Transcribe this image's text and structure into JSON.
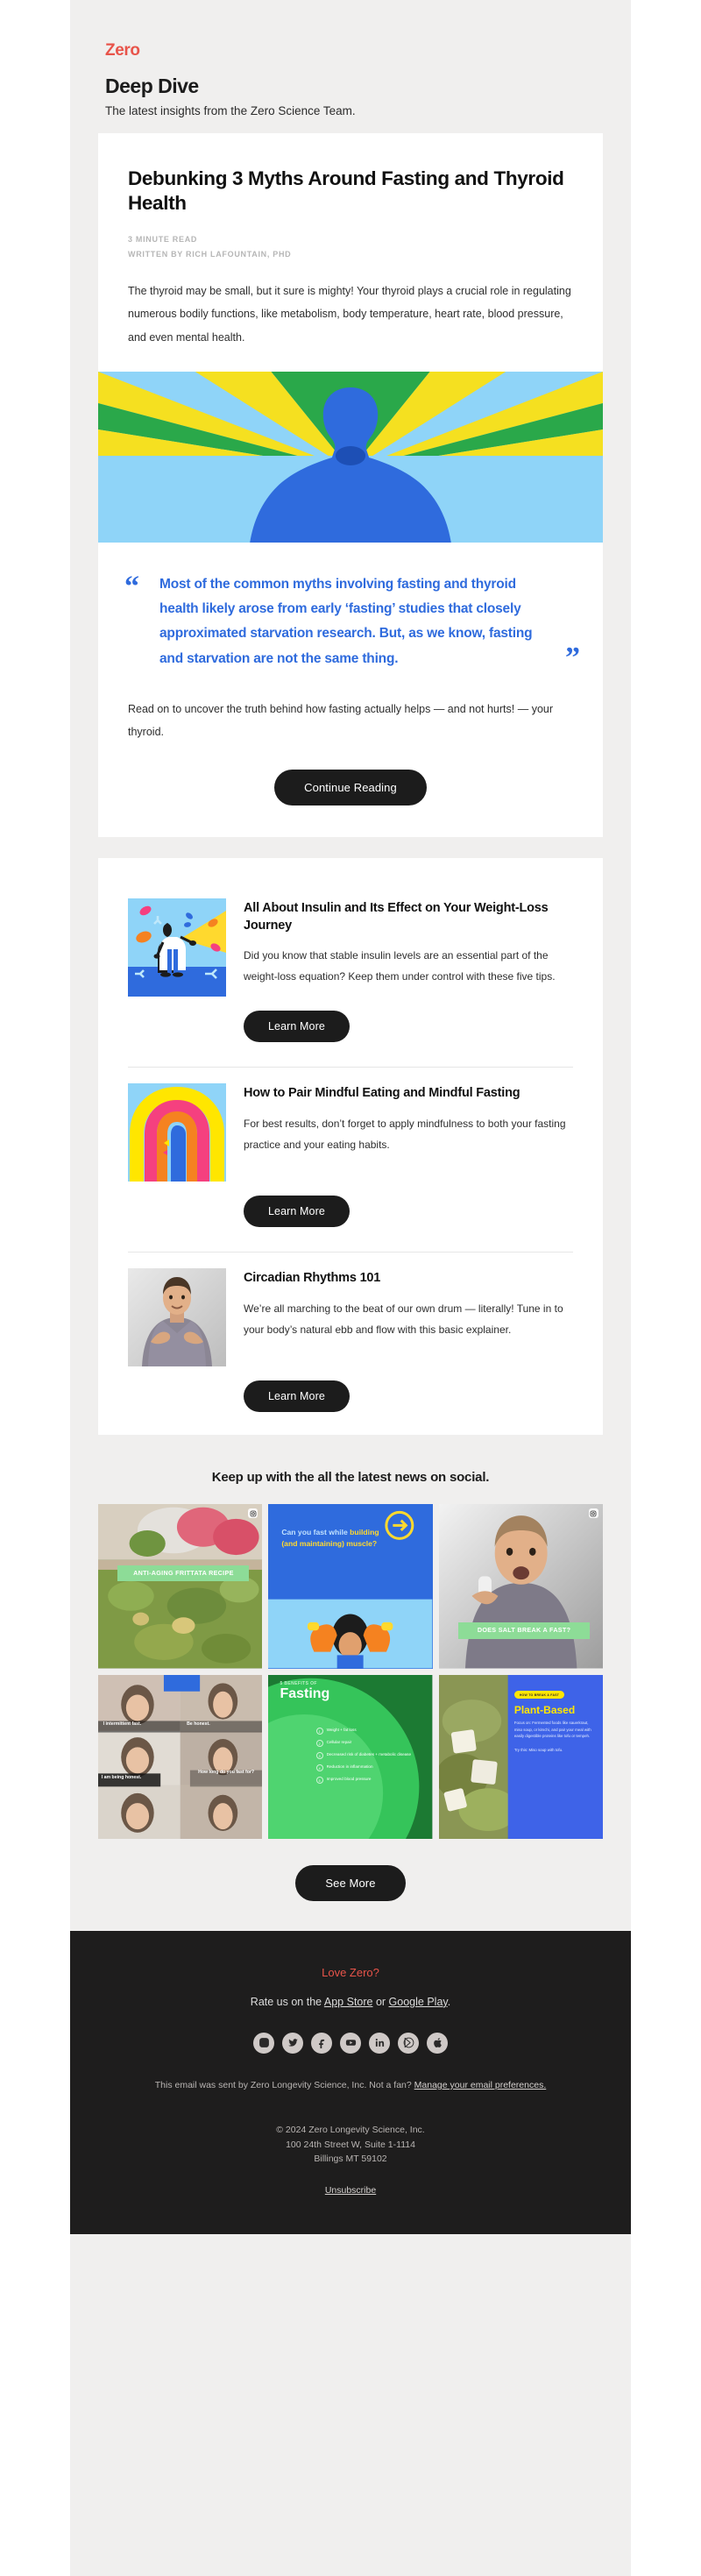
{
  "brand": {
    "logo_text": "Zero",
    "accent_color": "#e8544a",
    "dark_color": "#1e1d1d",
    "quote_color": "#2f6bdd"
  },
  "masthead": {
    "title": "Deep Dive",
    "subtitle": "The latest insights from the Zero Science Team."
  },
  "feature": {
    "title": "Debunking 3 Myths Around Fasting and Thyroid Health",
    "read_time": "3 MINUTE READ",
    "byline": "WRITTEN BY RICH LAFOUNTAIN, PHD",
    "intro": "The thyroid may be small, but it sure is mighty! Your thyroid plays a crucial role in regulating numerous bodily functions, like metabolism, body temperature, heart rate, blood pressure, and even mental health.",
    "quote_open": "“",
    "quote_close": "”",
    "quote": "Most of the common myths involving fasting and thyroid health likely arose from early ‘fasting’ studies that closely approximated starvation research. But, as we know, fasting and starvation are not the same thing.",
    "outro": "Read on to uncover the truth behind how fasting actually helps — and not hurts! — your thyroid.",
    "cta_label": "Continue Reading"
  },
  "articles": [
    {
      "title": "All About Insulin and Its Effect on Your Weight-Loss Journey",
      "excerpt": "Did you know that stable insulin levels are an essential part of the weight-loss equation? Keep them under control with these five tips.",
      "cta_label": "Learn More",
      "thumb": "scientist-illustration"
    },
    {
      "title": "How to Pair Mindful Eating and Mindful Fasting",
      "excerpt": "For best results, don’t forget to apply mindfulness to both your fasting practice and your eating habits.",
      "cta_label": "Learn More",
      "thumb": "rainbow-head-illustration"
    },
    {
      "title": "Circadian Rhythms 101",
      "excerpt": "We’re all marching to the beat of our own drum — literally! Tune in to your body’s natural ebb and flow with this basic explainer.",
      "cta_label": "Learn More",
      "thumb": "man-photo"
    }
  ],
  "social": {
    "heading": "Keep up with the all the latest news on social.",
    "see_more_label": "See More",
    "tiles": [
      {
        "name": "frittata-recipe-post",
        "caption": "ANTI-AGING FRITTATA  RECIPE",
        "badge": "instagram-badge"
      },
      {
        "name": "fast-building-muscle-post",
        "headline": "Can you fast while building (and maintaining) muscle?",
        "badge": "arrow-badge"
      },
      {
        "name": "salt-break-fast-post",
        "caption": "DOES SALT  BREAK A FAST?",
        "badge": "instagram-badge"
      },
      {
        "name": "interview-reel-post",
        "captions": [
          "I intermittent fast.",
          "Be honest.",
          "I am being honest.",
          "How long do you fast for?"
        ]
      },
      {
        "name": "benefits-of-fasting-post",
        "kicker": "5 BENEFITS OF",
        "headline": "Fasting",
        "items": [
          "Weight + fat loss",
          "Cellular repair",
          "Decreased risk of diabetes + metabolic disease",
          "Reduction in inflammation",
          "Improved blood pressure"
        ]
      },
      {
        "name": "plant-based-post",
        "kicker": "HOW TO BREAK A FAST",
        "headline": "Plant-Based",
        "body": "Focus on: Fermented foods like sauerkraut, miso soup, or kimchi, and pair your meal with easily digestible proteins like tofu or tempeh.",
        "tip": "Try this: Miso soup with tofu."
      }
    ]
  },
  "footer": {
    "love_text": "Love Zero?",
    "rate_prefix": "Rate us on the ",
    "app_store_label": "App Store",
    "rate_middle": " or ",
    "google_play_label": "Google Play",
    "rate_suffix": ".",
    "social_icons": [
      {
        "name": "instagram-icon"
      },
      {
        "name": "twitter-icon"
      },
      {
        "name": "facebook-icon"
      },
      {
        "name": "youtube-icon"
      },
      {
        "name": "linkedin-icon"
      },
      {
        "name": "google-play-icon"
      },
      {
        "name": "apple-icon"
      }
    ],
    "note_prefix": "This email was sent by Zero Longevity Science, Inc. Not a fan? ",
    "note_link": "Manage your email preferences.",
    "copyright": "© 2024 Zero Longevity Science, Inc.",
    "address_line1": "100 24th Street W, Suite 1-1114",
    "address_line2": "Billings MT 59102",
    "unsubscribe_label": "Unsubscribe"
  }
}
